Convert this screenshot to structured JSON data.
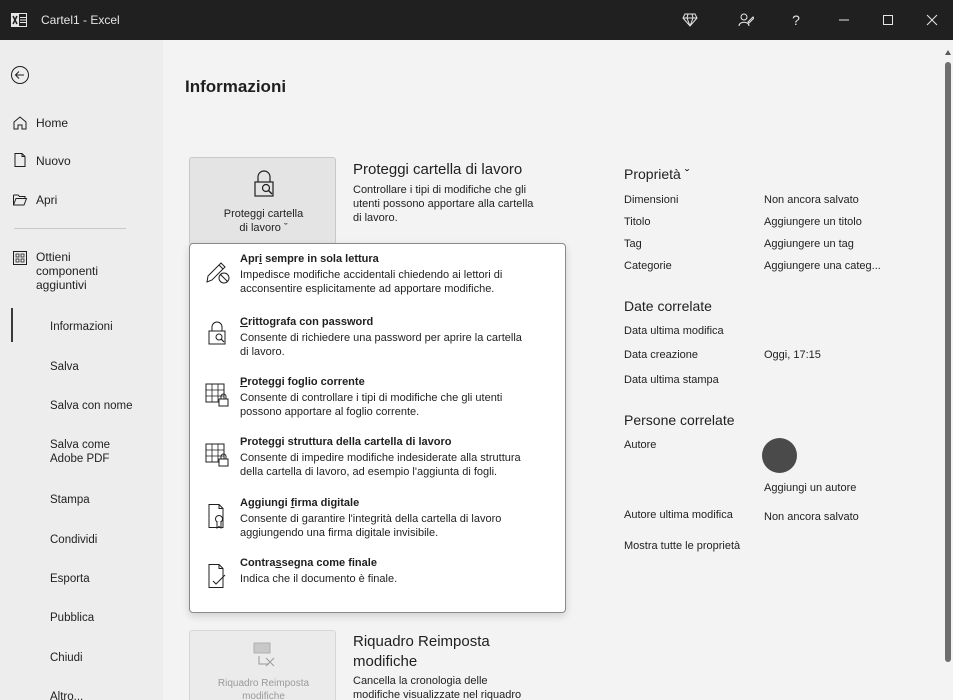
{
  "titlebar": {
    "title": "Cartel1 - Excel",
    "buttons": [
      "diamond-icon",
      "pen-person-icon",
      "help-icon",
      "minimize-icon",
      "maximize-icon",
      "close-icon"
    ],
    "help_label": "?"
  },
  "sidebar": {
    "items": [
      {
        "label": "Home",
        "icon": "home-icon"
      },
      {
        "label": "Nuovo",
        "icon": "new-document-icon"
      },
      {
        "label": "Apri",
        "icon": "folder-open-icon"
      },
      {
        "label": "Ottieni componenti aggiuntivi",
        "icon": "addins-grid-icon"
      }
    ],
    "sub": [
      "Informazioni",
      "Salva",
      "Salva con nome",
      "Salva come Adobe PDF",
      "Stampa",
      "Condividi",
      "Esporta",
      "Pubblica",
      "Chiudi",
      "Altro..."
    ],
    "active": "Informazioni"
  },
  "main": {
    "page_title": "Informazioni",
    "protect": {
      "button_label_1": "Proteggi cartella",
      "button_label_2": "di lavoro ˇ",
      "title": "Proteggi cartella di lavoro",
      "desc_1": "Controllare i tipi di modifiche che gli",
      "desc_2": "utenti possono apportare alla cartella",
      "desc_3": "di lavoro."
    },
    "dropdown": [
      {
        "title_pre": "Apr",
        "title_u": "i",
        "title_post": " sempre in sola lettura",
        "desc_1": "Impedisce modifiche accidentali chiedendo ai lettori di",
        "desc_2": "acconsentire esplicitamente ad apportare modifiche.",
        "icon": "pencil-no-icon"
      },
      {
        "title_pre": "",
        "title_u": "C",
        "title_post": "rittografa con password",
        "desc_1": "Consente di richiedere una password per aprire la cartella",
        "desc_2": "di lavoro.",
        "icon": "lock-key-icon"
      },
      {
        "title_pre": "",
        "title_u": "P",
        "title_post": "roteggi foglio corrente",
        "desc_1": "Consente di controllare i tipi di modifiche che gli utenti",
        "desc_2": "possono apportare al foglio corrente.",
        "icon": "sheet-lock-icon"
      },
      {
        "title_pre": "Proteggi struttura della cartella di lavoro",
        "title_u": "",
        "title_post": "",
        "desc_1": "Consente di impedire modifiche indesiderate alla struttura",
        "desc_2": "della cartella di lavoro, ad esempio l'aggiunta di fogli.",
        "icon": "workbook-lock-icon"
      },
      {
        "title_pre": "Aggiungi ",
        "title_u": "f",
        "title_post": "irma digitale",
        "desc_1": "Consente di garantire l'integrità della cartella di lavoro",
        "desc_2": "aggiungendo una firma digitale invisibile.",
        "icon": "signature-ribbon-icon"
      },
      {
        "title_pre": "Contra",
        "title_u": "s",
        "title_post": "segna come finale",
        "desc_1": "Indica che il documento è finale.",
        "desc_2": "",
        "icon": "document-check-icon"
      }
    ],
    "properties": {
      "title": "Proprietà ˇ",
      "rows": [
        {
          "k": "Dimensioni",
          "v": "Non ancora salvato"
        },
        {
          "k": "Titolo",
          "v": "Aggiungere un titolo"
        },
        {
          "k": "Tag",
          "v": "Aggiungere un tag"
        },
        {
          "k": "Categorie",
          "v": "Aggiungere una categ..."
        }
      ],
      "dates_title": "Date correlate",
      "dates": [
        {
          "k": "Data ultima modifica",
          "v": ""
        },
        {
          "k": "Data creazione",
          "v": "Oggi, 17:15"
        },
        {
          "k": "Data ultima stampa",
          "v": ""
        }
      ],
      "people_title": "Persone correlate",
      "author_label": "Autore",
      "add_author": "Aggiungi un autore",
      "last_modified_by_label": "Autore ultima modifica",
      "last_modified_by_value": "Non ancora salvato",
      "show_all": "Mostra tutte le proprietà"
    },
    "reset": {
      "button_label_1": "Riquadro Reimposta",
      "button_label_2": "modifiche",
      "title_1": "Riquadro Reimposta",
      "title_2": "modifiche",
      "desc_1": "Cancella la cronologia delle",
      "desc_2": "modifiche visualizzate nel riquadro"
    }
  }
}
